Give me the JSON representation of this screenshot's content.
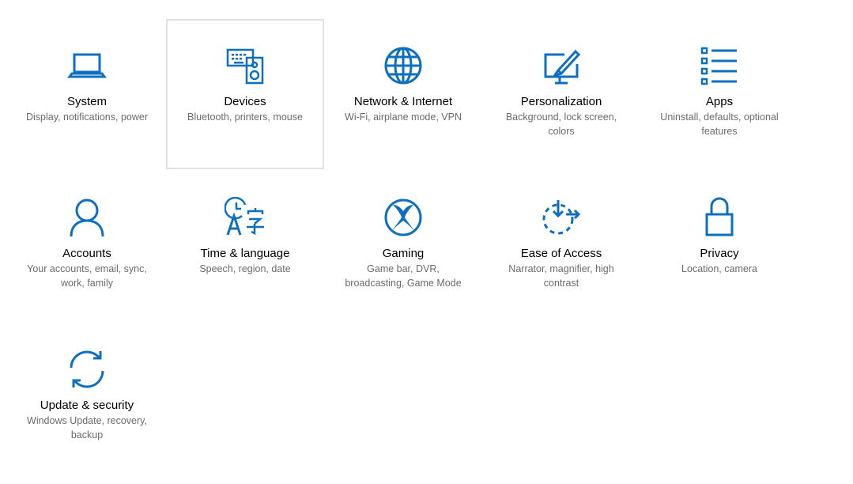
{
  "accent_color": "#0e6fc0",
  "tiles": [
    {
      "title": "System",
      "desc": "Display, notifications, power",
      "icon": "laptop-icon"
    },
    {
      "title": "Devices",
      "desc": "Bluetooth, printers, mouse",
      "icon": "devices-icon",
      "selected": true
    },
    {
      "title": "Network & Internet",
      "desc": "Wi-Fi, airplane mode, VPN",
      "icon": "globe-icon"
    },
    {
      "title": "Personalization",
      "desc": "Background, lock screen, colors",
      "icon": "paintbrush-icon"
    },
    {
      "title": "Apps",
      "desc": "Uninstall, defaults, optional features",
      "icon": "apps-list-icon"
    },
    {
      "title": "Accounts",
      "desc": "Your accounts, email, sync, work, family",
      "icon": "person-icon"
    },
    {
      "title": "Time & language",
      "desc": "Speech, region, date",
      "icon": "time-language-icon"
    },
    {
      "title": "Gaming",
      "desc": "Game bar, DVR, broadcasting, Game Mode",
      "icon": "xbox-icon"
    },
    {
      "title": "Ease of Access",
      "desc": "Narrator, magnifier, high contrast",
      "icon": "ease-of-access-icon"
    },
    {
      "title": "Privacy",
      "desc": "Location, camera",
      "icon": "lock-icon"
    },
    {
      "title": "Update & security",
      "desc": "Windows Update, recovery, backup",
      "icon": "sync-icon"
    }
  ]
}
